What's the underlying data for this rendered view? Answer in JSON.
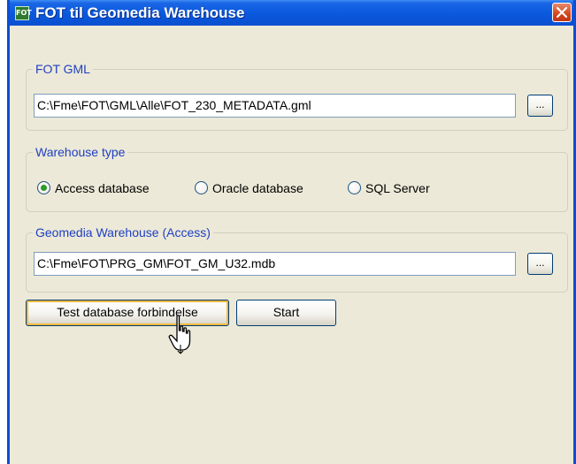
{
  "window": {
    "title": "FOT til Geomedia Warehouse",
    "icon_name": "fot-app-icon",
    "icon_text": "FOT"
  },
  "fot_gml": {
    "legend": "FOT GML",
    "path": "C:\\Fme\\FOT\\GML\\Alle\\FOT_230_METADATA.gml",
    "browse_label": "..."
  },
  "warehouse_type": {
    "legend": "Warehouse type",
    "options": [
      {
        "label": "Access database",
        "selected": true
      },
      {
        "label": "Oracle database",
        "selected": false
      },
      {
        "label": "SQL Server",
        "selected": false
      }
    ]
  },
  "geomedia_warehouse": {
    "legend": "Geomedia Warehouse (Access)",
    "path": "C:\\Fme\\FOT\\PRG_GM\\FOT_GM_U32.mdb",
    "browse_label": "..."
  },
  "actions": {
    "test_label": "Test database forbindelse",
    "start_label": "Start"
  },
  "colors": {
    "titlebar": "#0a58dc",
    "legend_text": "#1f3fc2",
    "dialog_bg": "#ece9d8",
    "close_button": "#d4451d",
    "radio_dot": "#2c9a2c",
    "focus_ring": "#f8b93f"
  }
}
